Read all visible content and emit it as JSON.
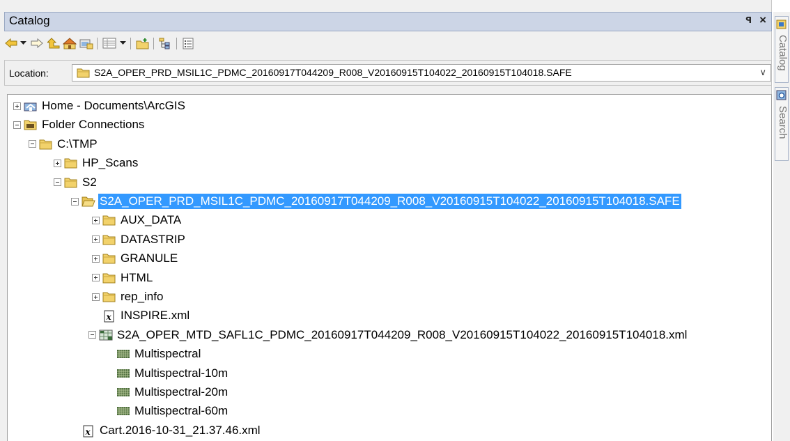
{
  "window": {
    "title": "Catalog",
    "pin_glyph": "ꟼ",
    "close_glyph": "×"
  },
  "toolbar": {
    "buttons": [
      {
        "name": "back-icon"
      },
      {
        "name": "back-dropdown-icon"
      },
      {
        "name": "forward-icon"
      },
      {
        "name": "up-one-level-icon"
      },
      {
        "name": "home-folder-icon"
      },
      {
        "name": "connect-folder-icon"
      },
      {
        "name": "view-details-icon"
      },
      {
        "name": "view-dropdown-icon"
      },
      {
        "name": "new-folder-icon"
      },
      {
        "name": "toggle-contents-icon"
      },
      {
        "name": "options-icon"
      }
    ]
  },
  "location": {
    "label": "Location:",
    "value": "S2A_OPER_PRD_MSIL1C_PDMC_20160917T044209_R008_V20160915T104022_20160915T104018.SAFE",
    "chevron": "∨"
  },
  "tree": {
    "items": [
      {
        "label": "Home - Documents\\ArcGIS",
        "expander": "plus",
        "icon": "home-folder"
      },
      {
        "label": "Folder Connections",
        "expander": "minus",
        "icon": "folder-connections"
      },
      {
        "label": "C:\\TMP",
        "expander": "minus",
        "icon": "folder"
      },
      {
        "label": "HP_Scans",
        "expander": "plus",
        "icon": "folder"
      },
      {
        "label": "S2",
        "expander": "minus",
        "icon": "folder"
      },
      {
        "label": "S2A_OPER_PRD_MSIL1C_PDMC_20160917T044209_R008_V20160915T104022_20160915T104018.SAFE",
        "expander": "minus",
        "icon": "folder-open",
        "selected": true
      },
      {
        "label": "AUX_DATA",
        "expander": "plus",
        "icon": "folder"
      },
      {
        "label": "DATASTRIP",
        "expander": "plus",
        "icon": "folder"
      },
      {
        "label": "GRANULE",
        "expander": "plus",
        "icon": "folder"
      },
      {
        "label": "HTML",
        "expander": "plus",
        "icon": "folder"
      },
      {
        "label": "rep_info",
        "expander": "plus",
        "icon": "folder"
      },
      {
        "label": "INSPIRE.xml",
        "expander": "none",
        "icon": "xml-file"
      },
      {
        "label": "S2A_OPER_MTD_SAFL1C_PDMC_20160917T044209_R008_V20160915T104022_20160915T104018.xml",
        "expander": "minus",
        "icon": "raster-product"
      },
      {
        "label": "Multispectral",
        "expander": "none",
        "icon": "raster-dataset"
      },
      {
        "label": "Multispectral-10m",
        "expander": "none",
        "icon": "raster-dataset"
      },
      {
        "label": "Multispectral-20m",
        "expander": "none",
        "icon": "raster-dataset"
      },
      {
        "label": "Multispectral-60m",
        "expander": "none",
        "icon": "raster-dataset"
      },
      {
        "label": "Cart.2016-10-31_21.37.46.xml",
        "expander": "none",
        "icon": "xml-file"
      }
    ]
  },
  "dock": {
    "tabs": [
      {
        "label": "Catalog"
      },
      {
        "label": "Search"
      }
    ]
  },
  "colors": {
    "selection": "#3399ff",
    "folder": "#f2d26b",
    "titlebar": "#ccd5e6"
  }
}
